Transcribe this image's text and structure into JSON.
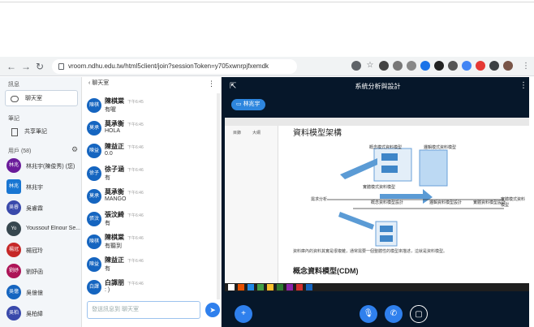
{
  "browser": {
    "url": "vroom.ndhu.edu.tw/html5client/join?sessionToken=y705xwnrpjfxemdk"
  },
  "left_panel": {
    "messages_heading": "訊息",
    "public_chat": "聊天室",
    "notes_heading": "筆記",
    "shared_notes": "共享筆記",
    "users_heading": "用戶 (58)",
    "users": [
      {
        "avatar": "林兆",
        "name": "林兆宇(陳俊秀) (您)",
        "color": "#6a1b9a"
      },
      {
        "avatar": "林兆",
        "name": "林兆宇",
        "color": "#1976d2"
      },
      {
        "avatar": "吳睿",
        "name": "吳睿霖",
        "color": "#3949ab"
      },
      {
        "avatar": "Yo",
        "name": "Youssouf Elnour Se...",
        "color": "#37474f"
      },
      {
        "avatar": "楊冠",
        "name": "楊冠玲",
        "color": "#c62828"
      },
      {
        "avatar": "劉妤",
        "name": "劉妤函",
        "color": "#ad1457"
      },
      {
        "avatar": "吳億",
        "name": "吳億億",
        "color": "#1565c0"
      },
      {
        "avatar": "吳柏",
        "name": "吳柏緯",
        "color": "#3949ab"
      }
    ]
  },
  "chat": {
    "title": "聊天室",
    "messages": [
      {
        "avatar": "陳棋",
        "name": "陳棋棠",
        "time": "下午6:45",
        "text": "有喔"
      },
      {
        "avatar": "莫承",
        "name": "莫承衡",
        "time": "下午6:45",
        "text": "HOLA"
      },
      {
        "avatar": "陳益",
        "name": "陳益正",
        "time": "下午6:46",
        "text": "0.0"
      },
      {
        "avatar": "徐子",
        "name": "徐子涵",
        "time": "下午6:46",
        "text": "有"
      },
      {
        "avatar": "莫承",
        "name": "莫承衡",
        "time": "下午6:46",
        "text": "MANGO"
      },
      {
        "avatar": "張汶",
        "name": "張汶綺",
        "time": "下午6:46",
        "text": "有"
      },
      {
        "avatar": "陳棋",
        "name": "陳棋棠",
        "time": "下午6:46",
        "text": "有聽到"
      },
      {
        "avatar": "陳益",
        "name": "陳益正",
        "time": "下午6:46",
        "text": "有"
      },
      {
        "avatar": "白譯",
        "name": "白譯朋",
        "time": "下午6:46",
        "text": ": )"
      }
    ],
    "input_placeholder": "發送訊息到 聊天室"
  },
  "main": {
    "title": "系統分析與設計",
    "presenter": "林兆宇"
  },
  "slide": {
    "tabs": [
      "目錄",
      "大綱"
    ],
    "heading": "資料模型架構",
    "label_conceptual": "概念模式資料模型",
    "label_logical": "邏輯模式資料模型",
    "label_physical": "實體模式資料模型",
    "label_req": "需求分析",
    "label_concept_design": "概念資料模型設計",
    "label_logic_design": "邏輯資料模型設計",
    "label_phys_design": "實體資料模型設計",
    "label_physical2": "實體模式資料模型",
    "section_title": "概念資料模型(CDM)",
    "body_text": "資料庫內的資料其實是很複雜，通常需要一個整體性的模型來描述，這就是資料模型。"
  }
}
